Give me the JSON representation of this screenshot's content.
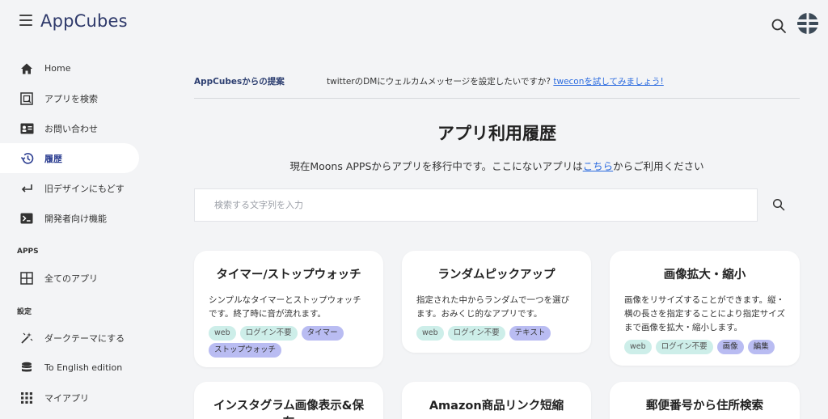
{
  "header": {
    "brand": "AppCubes"
  },
  "sidebar": {
    "items": [
      {
        "label": "Home",
        "icon": "home-icon"
      },
      {
        "label": "アプリを検索",
        "icon": "app-search-icon"
      },
      {
        "label": "お問い合わせ",
        "icon": "contact-card-icon"
      },
      {
        "label": "履歴",
        "icon": "history-icon",
        "active": true
      },
      {
        "label": "旧デザインにもどす",
        "icon": "return-arrow-icon"
      },
      {
        "label": "開発者向け機能",
        "icon": "terminal-icon"
      }
    ],
    "apps_section": "APPS",
    "apps_items": [
      {
        "label": "全てのアプリ",
        "icon": "grid-icon"
      }
    ],
    "settings_section": "設定",
    "settings_items": [
      {
        "label": "ダークテーマにする",
        "icon": "theme-wand-icon"
      },
      {
        "label": "To English edition",
        "icon": "database-icon"
      },
      {
        "label": "マイアプリ",
        "icon": "apps-dots-icon"
      }
    ]
  },
  "promo": {
    "label": "AppCubesからの提案",
    "text": "twitterのDMにウェルカムメッセージを設定したいですか? ",
    "link": "tweconを試してみましょう!"
  },
  "main": {
    "title": "アプリ利用履歴",
    "notice_before": "現在Moons APPSからアプリを移行中です。ここにないアプリは",
    "notice_link": "こちら",
    "notice_after": "からご利用ください",
    "search_placeholder": "検索する文字列を入力"
  },
  "cards": [
    {
      "title": "タイマー/ストップウォッチ",
      "desc": "シンプルなタイマーとストップウォッチです。終了時に音が流れます。",
      "tags": [
        {
          "label": "web",
          "style": "light"
        },
        {
          "label": "ログイン不要",
          "style": "light"
        },
        {
          "label": "タイマー",
          "style": "purple"
        },
        {
          "label": "ストップウォッチ",
          "style": "purple"
        }
      ]
    },
    {
      "title": "ランダムピックアップ",
      "desc": "指定された中からランダムで一つを選びます。おみくじ的なアプリです。",
      "tags": [
        {
          "label": "web",
          "style": "light"
        },
        {
          "label": "ログイン不要",
          "style": "light"
        },
        {
          "label": "テキスト",
          "style": "purple"
        }
      ]
    },
    {
      "title": "画像拡大・縮小",
      "desc": "画像をリサイズすることができます。縦・横の長さを指定することにより指定サイズまで画像を拡大・縮小します。",
      "tags": [
        {
          "label": "web",
          "style": "light"
        },
        {
          "label": "ログイン不要",
          "style": "light"
        },
        {
          "label": "画像",
          "style": "purple"
        },
        {
          "label": "編集",
          "style": "purple"
        }
      ]
    },
    {
      "title": "インスタグラム画像表示&保存",
      "desc": "",
      "tags": []
    },
    {
      "title": "Amazon商品リンク短縮",
      "desc": "",
      "tags": []
    },
    {
      "title": "郵便番号から住所検索",
      "desc": "",
      "tags": []
    }
  ],
  "colors": {
    "background": "#f3f4f6",
    "brand": "#2f3a6b",
    "link": "#2d6cdf",
    "tag_light": "#cdeee9",
    "tag_purple": "#b9bcf2"
  }
}
